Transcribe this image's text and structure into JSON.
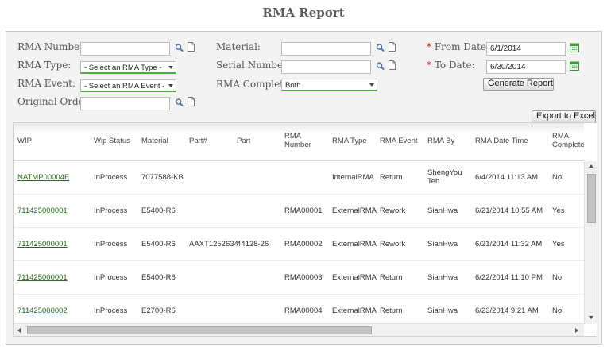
{
  "page_title": "RMA Report",
  "filters": {
    "rma_number": {
      "label": "RMA Number:",
      "value": ""
    },
    "rma_type": {
      "label": "RMA Type:",
      "value": "- Select an RMA Type -"
    },
    "rma_event": {
      "label": "RMA Event:",
      "value": "- Select an RMA Event -"
    },
    "original_order": {
      "label": "Original Order:",
      "value": ""
    },
    "material": {
      "label": "Material:",
      "value": ""
    },
    "serial_number": {
      "label": "Serial Number:",
      "value": ""
    },
    "rma_complete": {
      "label": "RMA Complete:",
      "value": "Both"
    },
    "from_date": {
      "required_mark": "*",
      "label": "From Date:",
      "value": "6/1/2014"
    },
    "to_date": {
      "required_mark": "*",
      "label": "To Date:",
      "value": "6/30/2014"
    },
    "generate_button": "Generate Report"
  },
  "export_button": "Export to Excel",
  "grid": {
    "headers": {
      "wip": "WIP",
      "wip_status": "Wip Status",
      "material": "Material",
      "part_no": "Part#",
      "part": "Part",
      "rma_number_1": "RMA",
      "rma_number_2": "Number",
      "rma_type": "RMA Type",
      "rma_event": "RMA Event",
      "rma_by": "RMA By",
      "rma_date_time": "RMA Date Time",
      "rma_complete_1": "RMA",
      "rma_complete_2": "Complete"
    },
    "rows": [
      {
        "wip": "NATMP00004E",
        "wip_status": "InProcess",
        "material": "7077588-KB",
        "part_no": "",
        "part": "",
        "rma_number": "",
        "rma_type": "InternalRMA",
        "rma_event": "Return",
        "rma_by_1": "ShengYou",
        "rma_by_2": "Teh",
        "rma_date_time": "6/4/2014 11:13 AM",
        "rma_complete": "No"
      },
      {
        "wip": "711425000001",
        "wip_status": "InProcess",
        "material": "E5400-R6",
        "part_no": "",
        "part": "",
        "rma_number": "RMA00001",
        "rma_type": "ExternalRMA",
        "rma_event": "Rework",
        "rma_by_1": "SianHwa",
        "rma_by_2": "",
        "rma_date_time": "6/21/2014 10:55 AM",
        "rma_complete": "Yes"
      },
      {
        "wip": "711425000001",
        "wip_status": "InProcess",
        "material": "E5400-R6",
        "part_no": "AAXT1252634",
        "part": "44128-26",
        "rma_number": "RMA00002",
        "rma_type": "ExternalRMA",
        "rma_event": "Rework",
        "rma_by_1": "SianHwa",
        "rma_by_2": "",
        "rma_date_time": "6/21/2014 11:32 AM",
        "rma_complete": "Yes"
      },
      {
        "wip": "711425000001",
        "wip_status": "InProcess",
        "material": "E5400-R6",
        "part_no": "",
        "part": "",
        "rma_number": "RMA00003",
        "rma_type": "ExternalRMA",
        "rma_event": "Return",
        "rma_by_1": "SianHwa",
        "rma_by_2": "",
        "rma_date_time": "6/22/2014 11:10 PM",
        "rma_complete": "No"
      },
      {
        "wip": "711425000002",
        "wip_status": "InProcess",
        "material": "E2700-R6",
        "part_no": "",
        "part": "",
        "rma_number": "RMA00004",
        "rma_type": "ExternalRMA",
        "rma_event": "Return",
        "rma_by_1": "SianHwa",
        "rma_by_2": "",
        "rma_date_time": "6/23/2014 9:21 AM",
        "rma_complete": "No"
      }
    ]
  },
  "colors": {
    "link": "#2a6a1a",
    "required": "#cc1f1f",
    "select_underline": "#4caa3a",
    "calendar_icon": "#3c9a3c"
  }
}
